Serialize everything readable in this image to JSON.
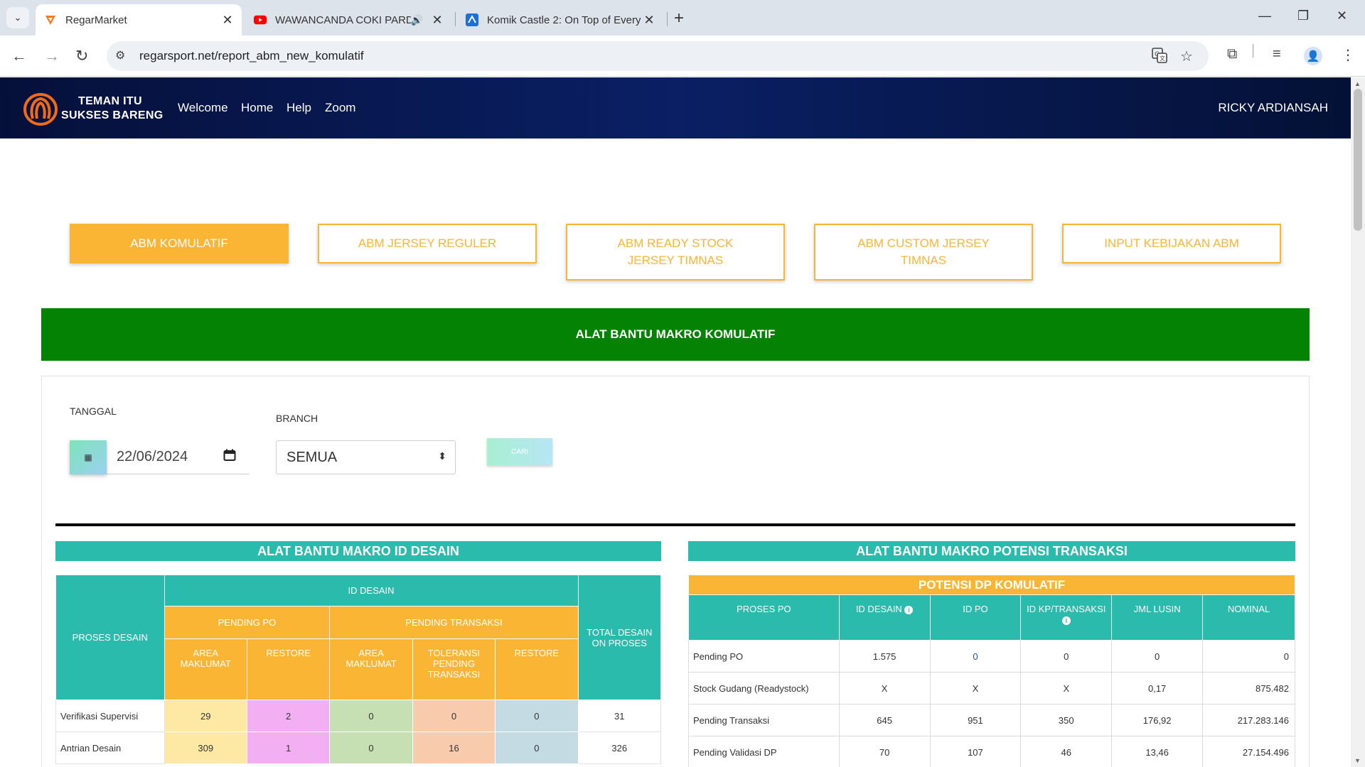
{
  "browser": {
    "tabs": [
      {
        "title": "RegarMarket",
        "active": true
      },
      {
        "title": "WAWANCANDA COKI PARD",
        "active": false
      },
      {
        "title": "Komik Castle 2: On Top of Every",
        "active": false
      }
    ],
    "url": "regarsport.net/report_abm_new_komulatif"
  },
  "header": {
    "logo_line1": "TEMAN ITU",
    "logo_line2": "SUKSES BARENG",
    "nav": [
      "Welcome",
      "Home",
      "Help",
      "Zoom"
    ],
    "user": "RICKY ARDIANSAH"
  },
  "page_tabs": [
    {
      "label_l1": "ABM KOMULATIF",
      "label_l2": "",
      "active": true
    },
    {
      "label_l1": "ABM JERSEY REGULER",
      "label_l2": "",
      "active": false
    },
    {
      "label_l1": "ABM READY STOCK",
      "label_l2": "JERSEY TIMNAS",
      "active": false
    },
    {
      "label_l1": "ABM CUSTOM JERSEY",
      "label_l2": "TIMNAS",
      "active": false
    },
    {
      "label_l1": "INPUT KEBIJAKAN ABM",
      "label_l2": "",
      "active": false
    }
  ],
  "banner": "ALAT BANTU MAKRO KOMULATIF",
  "filters": {
    "tanggal_label": "TANGGAL",
    "tanggal_value": "22/06/2024",
    "branch_label": "BRANCH",
    "branch_value": "SEMUA",
    "cari_label": "CARI"
  },
  "desain": {
    "title": "ALAT BANTU MAKRO ID DESAIN",
    "h_proses": "PROSES DESAIN",
    "h_id_desain": "ID DESAIN",
    "h_pending_po": "PENDING PO",
    "h_pending_trans": "PENDING TRANSAKSI",
    "h_total_l1": "TOTAL DESAIN",
    "h_total_l2": "ON PROSES",
    "h_area1_l1": "AREA",
    "h_area1_l2": "MAKLUMAT",
    "h_restore1": "RESTORE",
    "h_area2_l1": "AREA",
    "h_area2_l2": "MAKLUMAT",
    "h_tol_l1": "TOLERANSI",
    "h_tol_l2": "PENDING",
    "h_tol_l3": "TRANSAKSI",
    "h_restore2": "RESTORE",
    "rows": [
      {
        "label": "Verifikasi Supervisi",
        "v1": "29",
        "v2": "2",
        "v3": "0",
        "v4": "0",
        "v5": "0",
        "total": "31"
      },
      {
        "label": "Antrian Desain",
        "v1": "309",
        "v2": "1",
        "v3": "0",
        "v4": "16",
        "v5": "0",
        "total": "326"
      }
    ]
  },
  "potensi": {
    "title": "ALAT BANTU MAKRO POTENSI TRANSAKSI",
    "sub": "POTENSI DP KOMULATIF",
    "h_proses": "PROSES PO",
    "h_id_desain": "ID DESAIN",
    "h_id_po": "ID PO",
    "h_kp": "ID KP/TRANSAKSI",
    "h_lusin": "JML LUSIN",
    "h_nominal": "NOMINAL",
    "rows": [
      {
        "label": "Pending PO",
        "id_desain": "1.575",
        "id_po": "0",
        "kp": "0",
        "lusin": "0",
        "nominal": "0"
      },
      {
        "label": "Stock Gudang (Readystock)",
        "id_desain": "X",
        "id_po": "X",
        "kp": "X",
        "lusin": "0,17",
        "nominal": "875.482"
      },
      {
        "label": "Pending Transaksi",
        "id_desain": "645",
        "id_po": "951",
        "kp": "350",
        "lusin": "176,92",
        "nominal": "217.283.146"
      },
      {
        "label": "Pending Validasi DP",
        "id_desain": "70",
        "id_po": "107",
        "kp": "46",
        "lusin": "13,46",
        "nominal": "27.154.496"
      }
    ]
  }
}
